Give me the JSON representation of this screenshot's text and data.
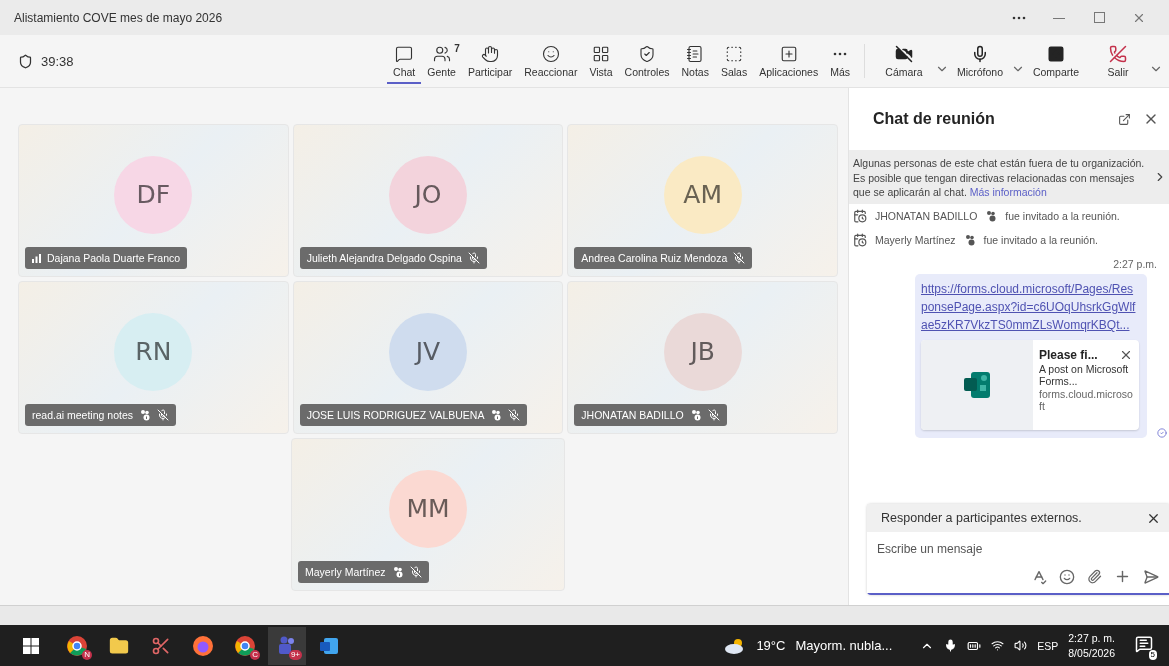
{
  "window": {
    "title": "Alistamiento COVE mes de mayo 2026"
  },
  "timer": "39:38",
  "toolbar": [
    {
      "kind": "chat",
      "label": "Chat",
      "selected": true
    },
    {
      "kind": "people",
      "label": "Gente",
      "badge": "7",
      "selected": false
    },
    {
      "kind": "hand",
      "label": "Participar",
      "selected": false
    },
    {
      "kind": "react",
      "label": "Reaccionar",
      "selected": false
    },
    {
      "kind": "view",
      "label": "Vista",
      "selected": false
    },
    {
      "kind": "controls",
      "label": "Controles",
      "selected": false
    },
    {
      "kind": "notes",
      "label": "Notas",
      "selected": false
    },
    {
      "kind": "rooms",
      "label": "Salas",
      "selected": false
    },
    {
      "kind": "apps",
      "label": "Aplicaciones",
      "selected": false
    },
    {
      "kind": "more",
      "label": "Más",
      "selected": false
    }
  ],
  "media": [
    {
      "kind": "camera",
      "label": "Cámara",
      "caret": true
    },
    {
      "kind": "mic",
      "label": "Micrófono",
      "caret": true
    },
    {
      "kind": "share",
      "label": "Comparte",
      "caret": false
    },
    {
      "kind": "leave",
      "label": "Salir",
      "caret": true
    }
  ],
  "tile_rows": [
    [
      {
        "initials": "DF",
        "name": "Dajana Paola Duarte Franco",
        "color": "#f7d7e6",
        "signal": true,
        "external": false,
        "muted": false
      },
      {
        "initials": "JO",
        "name": "Julieth Alejandra Delgado Ospina",
        "color": "#f3d3dc",
        "signal": false,
        "external": false,
        "muted": true
      },
      {
        "initials": "AM",
        "name": "Andrea Carolina Ruiz Mendoza",
        "color": "#faeac4",
        "signal": false,
        "external": false,
        "muted": true
      }
    ],
    [
      {
        "initials": "RN",
        "name": "read.ai meeting notes",
        "color": "#d7eef2",
        "signal": false,
        "external": true,
        "muted": true
      },
      {
        "initials": "JV",
        "name": "JOSE LUIS RODRIGUEZ VALBUENA",
        "color": "#cfdcee",
        "signal": false,
        "external": true,
        "muted": true
      },
      {
        "initials": "JB",
        "name": "JHONATAN BADILLO",
        "color": "#ead9d8",
        "signal": false,
        "external": true,
        "muted": true
      }
    ],
    [
      {
        "initials": "MM",
        "name": "Mayerly Martínez",
        "color": "#fbd9d2",
        "signal": false,
        "external": true,
        "muted": true
      }
    ]
  ],
  "chat": {
    "title": "Chat de reunión",
    "notice": "Algunas personas de este chat están fuera de tu organización. Es posible que tengan directivas relacionadas con mensajes que se aplicarán al chat.",
    "notice_link": "Más información",
    "events": [
      {
        "name": "JHONATAN BADILLO",
        "text": "fue invitado a la reunión."
      },
      {
        "name": "Mayerly Martínez",
        "text": "fue invitado a la reunión."
      }
    ],
    "message": {
      "time": "2:27 p.m.",
      "link": "https://forms.cloud.microsoft/Pages/ResponsePage.aspx?id=c6UOqUhsrkGgWlfae5zKR7VkzTS0mmZLsWomqrKBQt...",
      "card": {
        "title": "Please fi...",
        "description": "A post on Microsoft Forms...",
        "source": "forms.cloud.microsoft"
      }
    },
    "reply_banner": "Responder a participantes externos.",
    "compose": {
      "placeholder": "Escribe un mensaje"
    }
  },
  "taskbar": {
    "apps": [
      {
        "kind": "chrome",
        "badge": "N"
      },
      {
        "kind": "folder"
      },
      {
        "kind": "snip"
      },
      {
        "kind": "firefox"
      },
      {
        "kind": "chrome",
        "badge": "C"
      },
      {
        "kind": "teams",
        "badge": "9+"
      },
      {
        "kind": "word"
      }
    ],
    "weather": "19°C",
    "forecast": "Mayorm. nubla...",
    "language": "ESP",
    "time": "2:27 p. m.",
    "date": "8/05/2026",
    "notifications": "5"
  }
}
